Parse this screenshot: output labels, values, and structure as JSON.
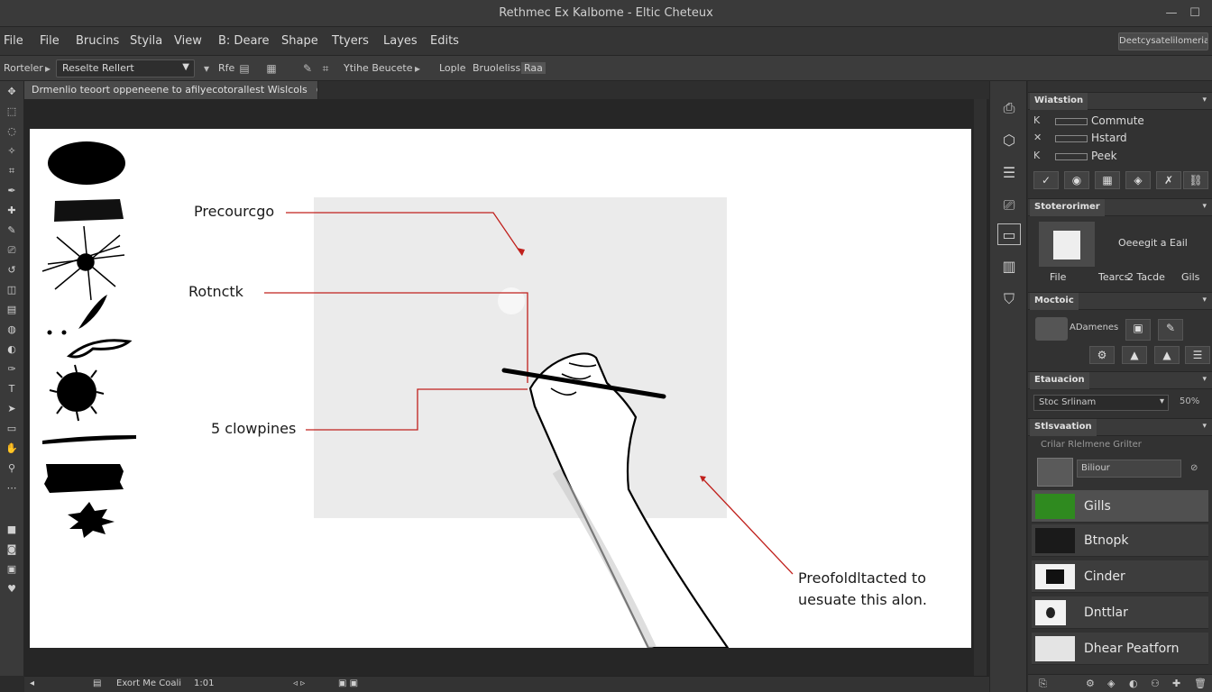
{
  "window": {
    "title": "Rethmec Ex Kalbome - Eltic Cheteux"
  },
  "menu": [
    "File",
    "File",
    "Brucins",
    "Styila",
    "View",
    "B: Deare",
    "Shape",
    "Ttyers",
    "Layes",
    "Edits"
  ],
  "workspace_button": "Deetcysatelilomerial",
  "options": {
    "tool_label": "Rorteler",
    "preset": "Reselte Rellert",
    "field_a": "Rfe",
    "field_b": "Ytihe Beucete",
    "field_c": "Lople",
    "field_d": "Bruoleliss",
    "field_e": "Raa"
  },
  "document_tab": "Drmenlio teoort oppeneene to afilyecotorallest Wislcols",
  "canvas": {
    "annotations": [
      {
        "text": "Precourcgo"
      },
      {
        "text": "Rotnctk"
      },
      {
        "text": "5 clowpines"
      },
      {
        "text": "Preofoldltacted to"
      },
      {
        "text": "uesuate this alon."
      }
    ]
  },
  "status": {
    "zoom_label": "Exort Me Coali",
    "zoom_value": "1:01"
  },
  "panels": {
    "history": {
      "title": "Wiatstion",
      "items": [
        "Commute",
        "Hstard",
        "Peek"
      ]
    },
    "libraries": {
      "title": "Stoterorimer",
      "doc_label": "Oeeegit a Eail",
      "cols": [
        "File",
        "Tearcs",
        "2 Tacde",
        "Gils"
      ]
    },
    "mode": {
      "title": "Moctoic",
      "label": "ADamenes"
    },
    "brush": {
      "title": "Etauacion",
      "dropdown": "Stoc Srlinam",
      "value": "50%"
    },
    "layers": {
      "title": "Stlsvaation",
      "subtitle": "Crilar Rlelmene Grilter",
      "search": "Biliour",
      "rows": [
        "Gills",
        "Btnopk",
        "Cinder",
        "Dnttlar",
        "Dhear Peatforn"
      ]
    }
  }
}
